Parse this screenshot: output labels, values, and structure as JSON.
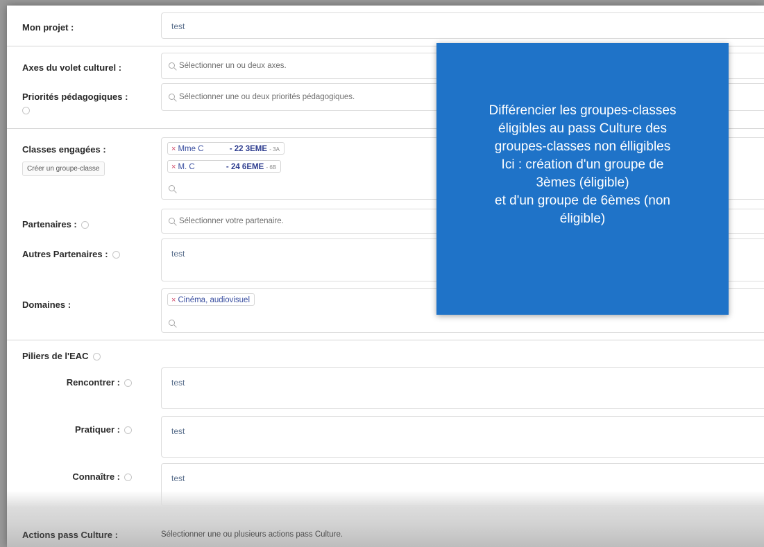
{
  "form": {
    "mon_projet": {
      "label": "Mon projet :",
      "value": "test"
    },
    "axes": {
      "label": "Axes du volet culturel :",
      "placeholder": "Sélectionner un ou deux axes."
    },
    "priorites": {
      "label": "Priorités pédagogiques :",
      "placeholder": "Sélectionner une ou deux priorités pédagogiques."
    },
    "classes": {
      "label": "Classes engagées :",
      "create_button": "Créer un groupe-classe",
      "tags": [
        {
          "teacher": "Mme C",
          "code": "- 22 3EME",
          "sub": "- 3A"
        },
        {
          "teacher": "M. C",
          "code": "- 24 6EME",
          "sub": "- 6B"
        }
      ]
    },
    "partenaires": {
      "label": "Partenaires :",
      "placeholder": "Sélectionner votre partenaire."
    },
    "autres_partenaires": {
      "label": "Autres Partenaires :",
      "value": "test"
    },
    "domaines": {
      "label": "Domaines :",
      "tags": [
        "Cinéma, audiovisuel"
      ]
    },
    "piliers": {
      "label": "Piliers de l'EAC",
      "rencontrer": {
        "label": "Rencontrer :",
        "value": "test"
      },
      "pratiquer": {
        "label": "Pratiquer :",
        "value": "test"
      },
      "connaitre": {
        "label": "Connaître :",
        "value": "test"
      }
    },
    "actions": {
      "label": "Actions pass Culture :",
      "placeholder": "Sélectionner une ou plusieurs actions pass Culture."
    }
  },
  "overlay": {
    "lines": [
      "Différencier les groupes-classes",
      "éligibles au pass Culture des",
      "groupes-classes non élligibles",
      "Ici : création d'un groupe de",
      "3èmes (éligible)",
      "et d'un groupe de 6èmes (non",
      "éligible)"
    ],
    "color": "#1f73c8"
  }
}
